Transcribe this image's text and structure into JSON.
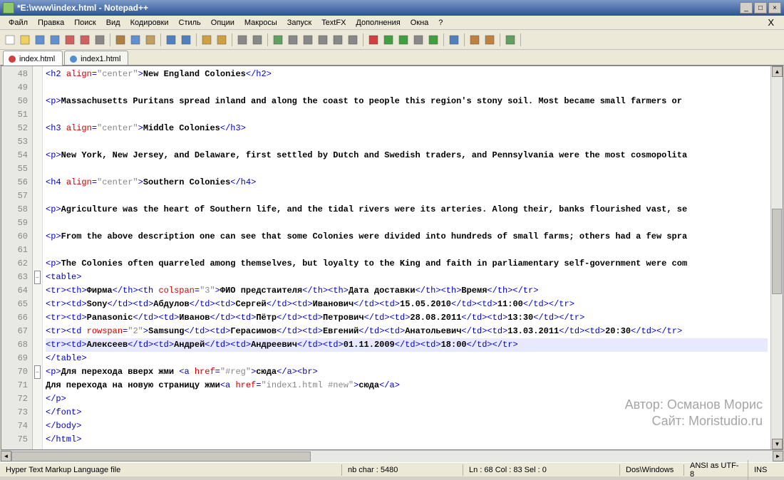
{
  "title": "*E:\\www\\index.html - Notepad++",
  "menus": [
    "Файл",
    "Правка",
    "Поиск",
    "Вид",
    "Кодировки",
    "Стиль",
    "Опции",
    "Макросы",
    "Запуск",
    "TextFX",
    "Дополнения",
    "Окна",
    "?"
  ],
  "tabs": [
    {
      "label": "index.html",
      "active": true,
      "dirty": true
    },
    {
      "label": "index1.html",
      "active": false,
      "dirty": false
    }
  ],
  "lines": [
    {
      "n": 48,
      "html": "<span class='t-tag'>&lt;<span class='t-tagname'>h2</span> <span class='t-attr'>align</span>=<span class='t-str'>\"center\"</span>&gt;</span><span class='t-txt'>New England Colonies</span><span class='t-tag'>&lt;/<span class='t-tagname'>h2</span>&gt;</span>"
    },
    {
      "n": 49,
      "html": ""
    },
    {
      "n": 50,
      "html": "<span class='t-tag'>&lt;<span class='t-tagname'>p</span>&gt;</span><span class='t-txt'>Massachusetts Puritans spread inland and along the coast to people this region's stony soil. Most became small farmers or </span>"
    },
    {
      "n": 51,
      "html": ""
    },
    {
      "n": 52,
      "html": "<span class='t-tag'>&lt;<span class='t-tagname'>h3</span> <span class='t-attr'>align</span>=<span class='t-str'>\"center\"</span>&gt;</span><span class='t-txt'>Middle Colonies</span><span class='t-tag'>&lt;/<span class='t-tagname'>h3</span>&gt;</span>"
    },
    {
      "n": 53,
      "html": ""
    },
    {
      "n": 54,
      "html": "<span class='t-tag'>&lt;<span class='t-tagname'>p</span>&gt;</span><span class='t-txt'>New York, New Jersey, and Delaware, first settled by Dutch and Swedish traders, and Pennsylvania were the most cosmopolita</span>"
    },
    {
      "n": 55,
      "html": ""
    },
    {
      "n": 56,
      "html": "<span class='t-tag'>&lt;<span class='t-tagname'>h4</span> <span class='t-attr'>align</span>=<span class='t-str'>\"center\"</span>&gt;</span><span class='t-txt'>Southern Colonies</span><span class='t-tag'>&lt;/<span class='t-tagname'>h4</span>&gt;</span>"
    },
    {
      "n": 57,
      "html": ""
    },
    {
      "n": 58,
      "html": "<span class='t-tag'>&lt;<span class='t-tagname'>p</span>&gt;</span><span class='t-txt'>Agriculture was the heart of Southern life, and the tidal rivers were its arteries. Along their, banks flourished vast, se</span>"
    },
    {
      "n": 59,
      "html": ""
    },
    {
      "n": 60,
      "html": "<span class='t-tag'>&lt;<span class='t-tagname'>p</span>&gt;</span><span class='t-txt'>From the above description one can see that some Colonies were divided into hundreds of small farms; others had a few spra</span>"
    },
    {
      "n": 61,
      "html": ""
    },
    {
      "n": 62,
      "html": "<span class='t-tag'>&lt;<span class='t-tagname'>p</span>&gt;</span><span class='t-txt'>The Colonies often quarreled among themselves, but loyalty to the King and faith in parliamentary self-government were com</span>"
    },
    {
      "n": 63,
      "fold": "-",
      "html": "<span class='t-tag'>&lt;<span class='t-tagname'>table</span>&gt;</span>"
    },
    {
      "n": 64,
      "html": "<span class='t-tag'>&lt;<span class='t-tagname'>tr</span>&gt;&lt;<span class='t-tagname'>th</span>&gt;</span><span class='t-txt'>Фирма</span><span class='t-tag'>&lt;/<span class='t-tagname'>th</span>&gt;&lt;<span class='t-tagname'>th</span> <span class='t-attr'>colspan</span>=<span class='t-str'>\"3\"</span>&gt;</span><span class='t-txt'>ФИО предстаителя</span><span class='t-tag'>&lt;/<span class='t-tagname'>th</span>&gt;&lt;<span class='t-tagname'>th</span>&gt;</span><span class='t-txt'>Дата доставки</span><span class='t-tag'>&lt;/<span class='t-tagname'>th</span>&gt;&lt;<span class='t-tagname'>th</span>&gt;</span><span class='t-txt'>Время</span><span class='t-tag'>&lt;/<span class='t-tagname'>th</span>&gt;&lt;/<span class='t-tagname'>tr</span>&gt;</span>"
    },
    {
      "n": 65,
      "html": "<span class='t-tag'>&lt;<span class='t-tagname'>tr</span>&gt;&lt;<span class='t-tagname'>td</span>&gt;</span><span class='t-txt'>Sony</span><span class='t-tag'>&lt;/<span class='t-tagname'>td</span>&gt;&lt;<span class='t-tagname'>td</span>&gt;</span><span class='t-txt'>Абдулов</span><span class='t-tag'>&lt;/<span class='t-tagname'>td</span>&gt;&lt;<span class='t-tagname'>td</span>&gt;</span><span class='t-txt'>Сергей</span><span class='t-tag'>&lt;/<span class='t-tagname'>td</span>&gt;&lt;<span class='t-tagname'>td</span>&gt;</span><span class='t-txt'>Иванович</span><span class='t-tag'>&lt;/<span class='t-tagname'>td</span>&gt;&lt;<span class='t-tagname'>td</span>&gt;</span><span class='t-txt'>15.05.2010</span><span class='t-tag'>&lt;/<span class='t-tagname'>td</span>&gt;&lt;<span class='t-tagname'>td</span>&gt;</span><span class='t-txt'>11:00</span><span class='t-tag'>&lt;/<span class='t-tagname'>td</span>&gt;&lt;/<span class='t-tagname'>tr</span>&gt;</span>"
    },
    {
      "n": 66,
      "html": "<span class='t-tag'>&lt;<span class='t-tagname'>tr</span>&gt;&lt;<span class='t-tagname'>td</span>&gt;</span><span class='t-txt'>Panasonic</span><span class='t-tag'>&lt;/<span class='t-tagname'>td</span>&gt;&lt;<span class='t-tagname'>td</span>&gt;</span><span class='t-txt'>Иванов</span><span class='t-tag'>&lt;/<span class='t-tagname'>td</span>&gt;&lt;<span class='t-tagname'>td</span>&gt;</span><span class='t-txt'>Пётр</span><span class='t-tag'>&lt;/<span class='t-tagname'>td</span>&gt;&lt;<span class='t-tagname'>td</span>&gt;</span><span class='t-txt'>Петрович</span><span class='t-tag'>&lt;/<span class='t-tagname'>td</span>&gt;&lt;<span class='t-tagname'>td</span>&gt;</span><span class='t-txt'>28.08.2011</span><span class='t-tag'>&lt;/<span class='t-tagname'>td</span>&gt;&lt;<span class='t-tagname'>td</span>&gt;</span><span class='t-txt'>13:30</span><span class='t-tag'>&lt;/<span class='t-tagname'>td</span>&gt;&lt;/<span class='t-tagname'>tr</span>&gt;</span>"
    },
    {
      "n": 67,
      "html": "<span class='t-tag'>&lt;<span class='t-tagname'>tr</span>&gt;&lt;<span class='t-tagname'>td</span> <span class='t-attr'>rowspan</span>=<span class='t-str'>\"2\"</span>&gt;</span><span class='t-txt'>Samsung</span><span class='t-tag'>&lt;/<span class='t-tagname'>td</span>&gt;&lt;<span class='t-tagname'>td</span>&gt;</span><span class='t-txt'>Герасимов</span><span class='t-tag'>&lt;/<span class='t-tagname'>td</span>&gt;&lt;<span class='t-tagname'>td</span>&gt;</span><span class='t-txt'>Евгений</span><span class='t-tag'>&lt;/<span class='t-tagname'>td</span>&gt;&lt;<span class='t-tagname'>td</span>&gt;</span><span class='t-txt'>Анатольевич</span><span class='t-tag'>&lt;/<span class='t-tagname'>td</span>&gt;&lt;<span class='t-tagname'>td</span>&gt;</span><span class='t-txt'>13.03.2011</span><span class='t-tag'>&lt;/<span class='t-tagname'>td</span>&gt;&lt;<span class='t-tagname'>td</span>&gt;</span><span class='t-txt'>20:30</span><span class='t-tag'>&lt;/<span class='t-tagname'>td</span>&gt;&lt;/<span class='t-tagname'>tr</span>&gt;</span>"
    },
    {
      "n": 68,
      "hl": true,
      "html": "<span class='t-tag'>&lt;<span class='t-tagname'>tr</span>&gt;&lt;<span class='t-tagname'>td</span>&gt;</span><span class='t-txt'>Алексеев</span><span class='t-tag'>&lt;/<span class='t-tagname'>td</span>&gt;&lt;<span class='t-tagname'>td</span>&gt;</span><span class='t-txt'>Андрей</span><span class='t-tag'>&lt;/<span class='t-tagname'>td</span>&gt;&lt;<span class='t-tagname'>td</span>&gt;</span><span class='t-txt'>Андреевич</span><span class='t-tag'>&lt;/<span class='t-tagname'>td</span>&gt;&lt;<span class='t-tagname'>td</span>&gt;</span><span class='t-txt'>01.11.2009</span><span class='t-tag'>&lt;/<span class='t-tagname'>td</span>&gt;&lt;<span class='t-tagname'>td</span>&gt;</span><span class='t-txt'>18:00</span><span class='t-tag'>&lt;/<span class='t-tagname'>td</span>&gt;&lt;/<span class='t-tagname'>tr</span>&gt;</span>"
    },
    {
      "n": 69,
      "html": "<span class='t-tag'>&lt;/<span class='t-tagname'>table</span>&gt;</span>"
    },
    {
      "n": 70,
      "fold": "-",
      "html": "<span class='t-tag'>&lt;<span class='t-tagname'>p</span>&gt;</span><span class='t-txt'>Для перехода вверх жми </span><span class='t-tag'>&lt;<span class='t-tagname'>a</span> <span class='t-attr'>href</span>=<span class='t-str'>\"#reg\"</span>&gt;</span><span class='t-txt'>сюда</span><span class='t-tag'>&lt;/<span class='t-tagname'>a</span>&gt;&lt;<span class='t-tagname'>br</span>&gt;</span>"
    },
    {
      "n": 71,
      "html": "<span class='t-txt'>Для перехода на новую страницу жми</span><span class='t-tag'>&lt;<span class='t-tagname'>a</span> <span class='t-attr'>href</span>=<span class='t-str'>\"index1.html #new\"</span>&gt;</span><span class='t-txt'>сюда</span><span class='t-tag'>&lt;/<span class='t-tagname'>a</span>&gt;</span>"
    },
    {
      "n": 72,
      "html": "<span class='t-tag'>&lt;/<span class='t-tagname'>p</span>&gt;</span>"
    },
    {
      "n": 73,
      "html": "<span class='t-tag'>&lt;/<span class='t-tagname'>font</span>&gt;</span>"
    },
    {
      "n": 74,
      "html": "<span class='t-tag'>&lt;/<span class='t-tagname'>body</span>&gt;</span>"
    },
    {
      "n": 75,
      "html": "<span class='t-tag'>&lt;/<span class='t-tagname'>html</span>&gt;</span>"
    }
  ],
  "status": {
    "lang": "Hyper Text Markup Language file",
    "nbchar": "nb char : 5480",
    "pos": "Ln : 68   Col : 83   Sel : 0",
    "eol": "Dos\\Windows",
    "enc": "ANSI as UTF-8",
    "ins": "INS"
  },
  "watermark": {
    "l1": "Автор: Османов Морис",
    "l2": "Сайт: Moristudio.ru"
  },
  "toolbar_icons": [
    "new",
    "open",
    "save",
    "saveall",
    "close",
    "closeall",
    "print",
    "|",
    "cut",
    "copy",
    "paste",
    "|",
    "undo",
    "redo",
    "|",
    "find",
    "replace",
    "|",
    "zoomin",
    "zoomout",
    "|",
    "sync",
    "wrap",
    "chars",
    "indent",
    "fold",
    "unfold",
    "|",
    "rec",
    "play",
    "playm",
    "stop",
    "playmulti",
    "|",
    "bookmark",
    "|",
    "func1",
    "func2",
    "|",
    "spell",
    "|"
  ]
}
